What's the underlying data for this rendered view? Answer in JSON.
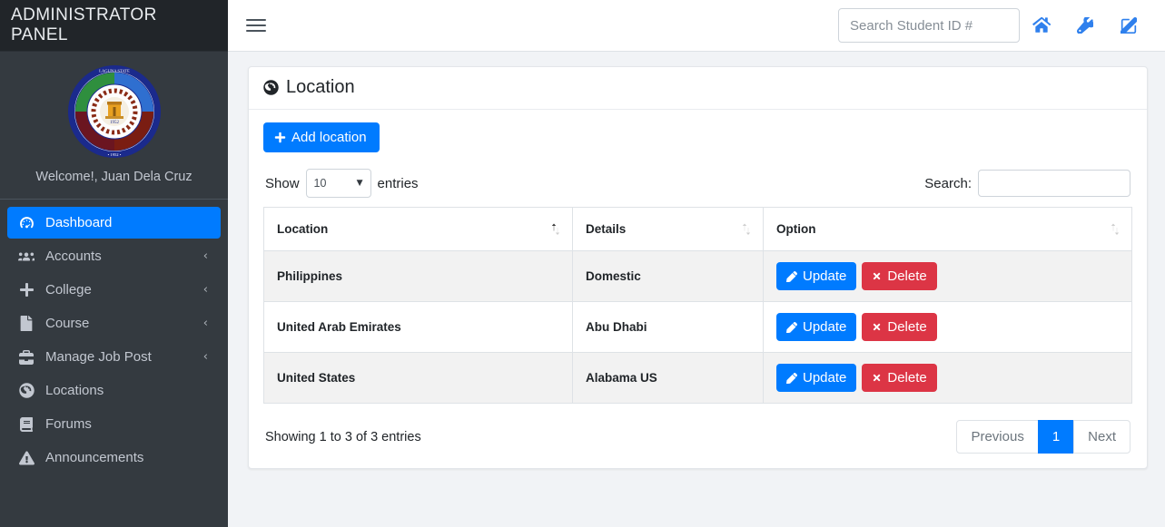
{
  "sidebar": {
    "brand_title": "ADMINISTRATOR PANEL",
    "welcome_text": "Welcome!, Juan Dela Cruz",
    "seal_text_top": "LAGUNA STATE POLYTECHNIC UNIVERSITY",
    "seal_year": "1952",
    "items": [
      {
        "label": "Dashboard",
        "icon": "dashboard-icon",
        "active": true,
        "chevron": ""
      },
      {
        "label": "Accounts",
        "icon": "users-icon",
        "active": false,
        "chevron": "‹"
      },
      {
        "label": "College",
        "icon": "plus-icon",
        "active": false,
        "chevron": "‹"
      },
      {
        "label": "Course",
        "icon": "file-icon",
        "active": false,
        "chevron": "‹"
      },
      {
        "label": "Manage Job Post",
        "icon": "briefcase-icon",
        "active": false,
        "chevron": "‹"
      },
      {
        "label": "Locations",
        "icon": "globe-icon",
        "active": false,
        "chevron": ""
      },
      {
        "label": "Forums",
        "icon": "book-icon",
        "active": false,
        "chevron": ""
      },
      {
        "label": "Announcements",
        "icon": "warning-icon",
        "active": false,
        "chevron": ""
      }
    ]
  },
  "topbar": {
    "menu_icon": "hamburger-icon",
    "search_placeholder": "Search Student ID #",
    "search_value": "",
    "icons": [
      "home-icon",
      "wrench-icon",
      "pen-to-square-icon"
    ]
  },
  "card": {
    "title": "Location",
    "title_icon": "globe-icon",
    "add_button_label": "Add location",
    "add_button_icon": "plus-icon"
  },
  "table_controls": {
    "show_label": "Show",
    "entries_label": "entries",
    "page_length": "10",
    "search_label": "Search:",
    "search_value": ""
  },
  "table": {
    "columns": [
      {
        "label": "Location",
        "sort": "asc"
      },
      {
        "label": "Details",
        "sort": "none"
      },
      {
        "label": "Option",
        "sort": "none"
      }
    ],
    "rows": [
      {
        "location": "Philippines",
        "details": "Domestic",
        "update_label": "Update",
        "delete_label": "Delete"
      },
      {
        "location": "United Arab Emirates",
        "details": "Abu Dhabi",
        "update_label": "Update",
        "delete_label": "Delete"
      },
      {
        "location": "United States",
        "details": "Alabama US",
        "update_label": "Update",
        "delete_label": "Delete"
      }
    ]
  },
  "footer": {
    "info": "Showing 1 to 3 of 3 entries",
    "previous_label": "Previous",
    "page_1_label": "1",
    "next_label": "Next"
  },
  "colors": {
    "primary": "#007bff",
    "danger": "#dc3545",
    "sidebar_bg": "#343a40",
    "brand_bg": "#212529",
    "page_bg": "#f1f3f6",
    "icon_blue": "#2f80ed"
  }
}
